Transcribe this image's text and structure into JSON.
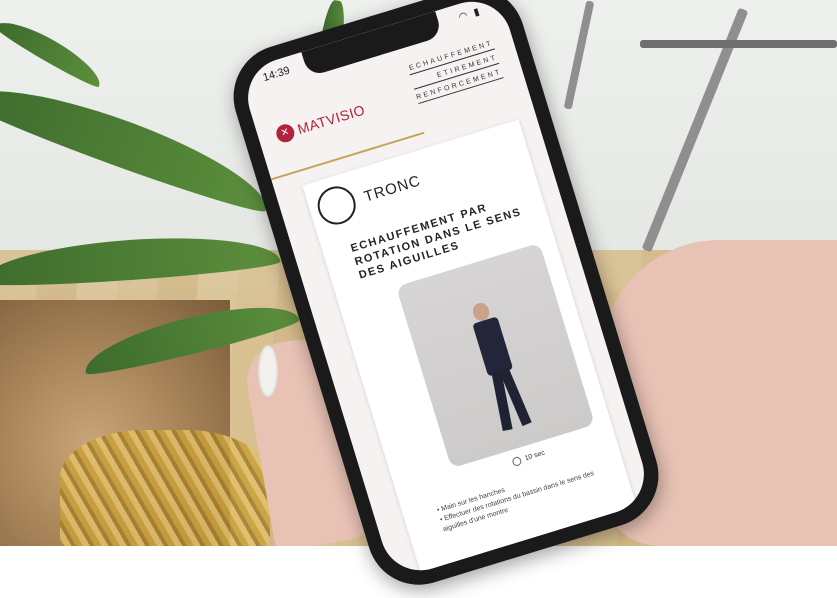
{
  "status": {
    "time": "14:39"
  },
  "app": {
    "logo_text": "MATVISIO",
    "accent": "#b3223b"
  },
  "nav": [
    "ECHAUFFEMENT",
    "ETIREMENT",
    "RENFORCEMENT"
  ],
  "section": {
    "title": "TRONC"
  },
  "exercise": {
    "title": "ECHAUFFEMENT PAR ROTATION DANS LE SENS DES AIGUILLES",
    "duration": "10 sec",
    "steps": [
      "Main sur les hanches",
      "Effectuer des rotations du bassin dans le sens des aiguilles d'une montre"
    ]
  },
  "icons": [
    "logo-icon",
    "clock-icon",
    "wifi-icon",
    "battery-icon"
  ]
}
